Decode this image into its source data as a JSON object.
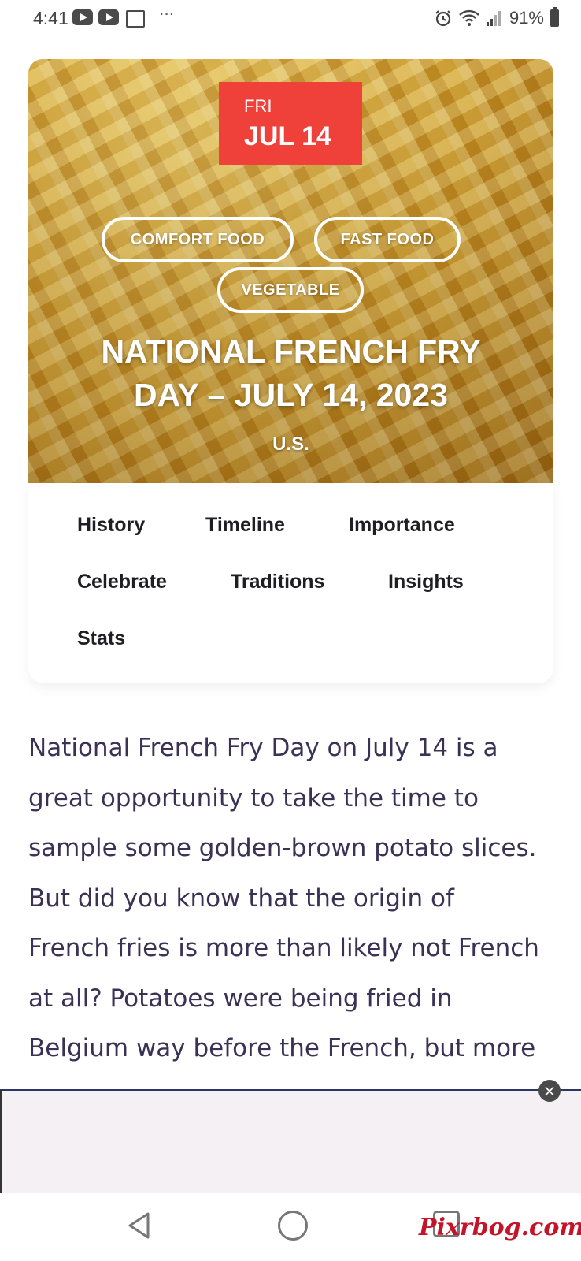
{
  "status_bar": {
    "time": "4:41",
    "battery": "91%"
  },
  "hero": {
    "day_of_week": "FRI",
    "month_day": "JUL 14",
    "tags": [
      "COMFORT FOOD",
      "FAST FOOD",
      "VEGETABLE"
    ],
    "title_line1": "NATIONAL FRENCH FRY",
    "title_line2": "DAY – JULY 14, 2023",
    "country": "U.S."
  },
  "nav_links": [
    "History",
    "Timeline",
    "Importance",
    "Celebrate",
    "Traditions",
    "Insights",
    "Stats"
  ],
  "article": {
    "lines": [
      "National French Fry Day on July 14 is a",
      "great opportunity to take the time to",
      "sample some golden-brown potato slices.",
      "But did you know that the origin of",
      "French fries is more than likely not French",
      "at all? Potatoes were being fried in",
      "Belgium way before the French, but more"
    ]
  },
  "ad": {
    "close_glyph": "×"
  },
  "watermark": "Pixrbog.com",
  "colors": {
    "badge": "#f0403a",
    "text": "#3a3155",
    "nav_text": "#1e1e24"
  }
}
